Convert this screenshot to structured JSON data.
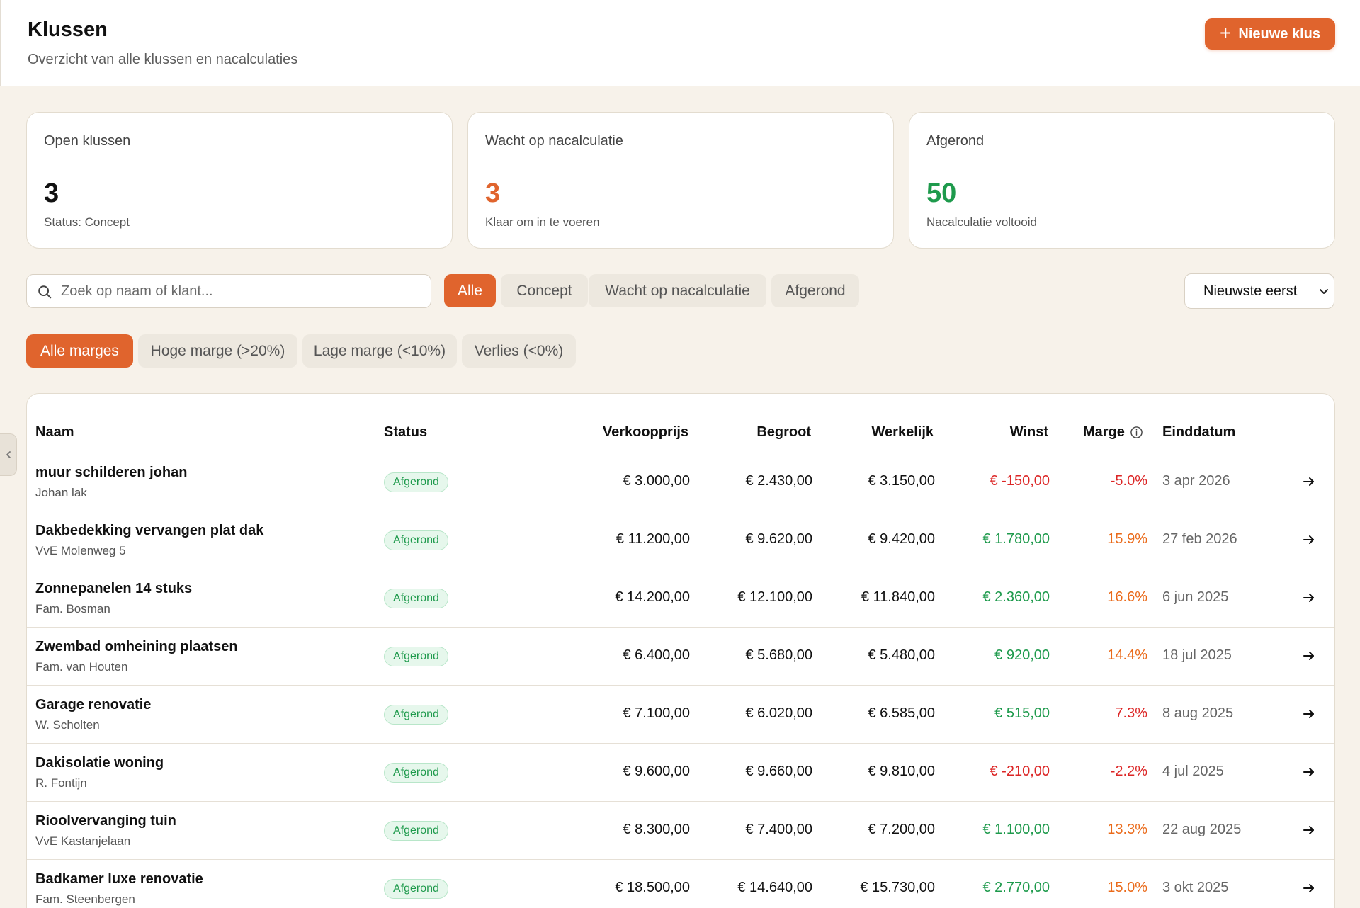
{
  "header": {
    "title": "Klussen",
    "subtitle": "Overzicht van alle klussen en nacalculaties",
    "new_button_label": "Nieuwe klus"
  },
  "cards": [
    {
      "label": "Open klussen",
      "value": "3",
      "sub": "Status: Concept"
    },
    {
      "label": "Wacht op nacalculatie",
      "value": "3",
      "sub": "Klaar om in te voeren"
    },
    {
      "label": "Afgerond",
      "value": "50",
      "sub": "Nacalculatie voltooid"
    }
  ],
  "colors": {
    "accent": "#e0642d",
    "positive": "#1e9a4c",
    "negative": "#dc2626",
    "warning": "#ea6a1a",
    "open_value": "#111111"
  },
  "search": {
    "placeholder": "Zoek op naam of klant..."
  },
  "status_filters": [
    "Alle",
    "Concept",
    "Wacht op nacalculatie",
    "Afgerond"
  ],
  "margin_filters": [
    "Alle marges",
    "Hoge marge (>20%)",
    "Lage marge (<10%)",
    "Verlies (<0%)"
  ],
  "sort": {
    "selected": "Nieuwste eerst"
  },
  "table": {
    "columns": {
      "name": "Naam",
      "status": "Status",
      "sale": "Verkoopprijs",
      "budget": "Begroot",
      "actual": "Werkelijk",
      "profit": "Winst",
      "margin": "Marge",
      "end": "Einddatum"
    },
    "rows": [
      {
        "name": "muur schilderen johan",
        "client": "Johan lak",
        "status": "Afgerond",
        "sale": "€ 3.000,00",
        "budget": "€ 2.430,00",
        "actual": "€ 3.150,00",
        "profit": "€ -150,00",
        "margin": "-5.0%",
        "end": "3 apr 2026"
      },
      {
        "name": "Dakbedekking vervangen plat dak",
        "client": "VvE Molenweg 5",
        "status": "Afgerond",
        "sale": "€ 11.200,00",
        "budget": "€ 9.620,00",
        "actual": "€ 9.420,00",
        "profit": "€ 1.780,00",
        "margin": "15.9%",
        "end": "27 feb 2026"
      },
      {
        "name": "Zonnepanelen 14 stuks",
        "client": "Fam. Bosman",
        "status": "Afgerond",
        "sale": "€ 14.200,00",
        "budget": "€ 12.100,00",
        "actual": "€ 11.840,00",
        "profit": "€ 2.360,00",
        "margin": "16.6%",
        "end": "6 jun 2025"
      },
      {
        "name": "Zwembad omheining plaatsen",
        "client": "Fam. van Houten",
        "status": "Afgerond",
        "sale": "€ 6.400,00",
        "budget": "€ 5.680,00",
        "actual": "€ 5.480,00",
        "profit": "€ 920,00",
        "margin": "14.4%",
        "end": "18 jul 2025"
      },
      {
        "name": "Garage renovatie",
        "client": "W. Scholten",
        "status": "Afgerond",
        "sale": "€ 7.100,00",
        "budget": "€ 6.020,00",
        "actual": "€ 6.585,00",
        "profit": "€ 515,00",
        "margin": "7.3%",
        "end": "8 aug 2025"
      },
      {
        "name": "Dakisolatie woning",
        "client": "R. Fontijn",
        "status": "Afgerond",
        "sale": "€ 9.600,00",
        "budget": "€ 9.660,00",
        "actual": "€ 9.810,00",
        "profit": "€ -210,00",
        "margin": "-2.2%",
        "end": "4 jul 2025"
      },
      {
        "name": "Rioolvervanging tuin",
        "client": "VvE Kastanjelaan",
        "status": "Afgerond",
        "sale": "€ 8.300,00",
        "budget": "€ 7.400,00",
        "actual": "€ 7.200,00",
        "profit": "€ 1.100,00",
        "margin": "13.3%",
        "end": "22 aug 2025"
      },
      {
        "name": "Badkamer luxe renovatie",
        "client": "Fam. Steenbergen",
        "status": "Afgerond",
        "sale": "€ 18.500,00",
        "budget": "€ 14.640,00",
        "actual": "€ 15.730,00",
        "profit": "€ 2.770,00",
        "margin": "15.0%",
        "end": "3 okt 2025"
      }
    ]
  }
}
